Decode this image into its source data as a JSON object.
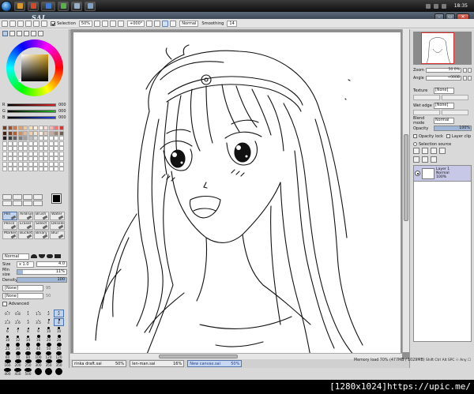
{
  "taskbar": {
    "clock": "18:35",
    "apps": [
      {
        "name": "folder",
        "color": "#d89a2c"
      },
      {
        "name": "browser",
        "color": "#d24a2e"
      },
      {
        "name": "media",
        "color": "#3f7ad0"
      },
      {
        "name": "app",
        "color": "#5ab04a"
      },
      {
        "name": "app",
        "color": "#9ab0c8"
      },
      {
        "name": "sai",
        "color": "#7fa3c8"
      }
    ]
  },
  "window": {
    "title": "SAI",
    "min_label": "–",
    "max_label": "▭",
    "close_label": "✕"
  },
  "menu": [
    "File(F)",
    "Edit(E)",
    "Canvas(C)",
    "Layer(L)",
    "Selection(S)",
    "Filter(T)",
    "View(V)",
    "Window(W)",
    "Help/Config(H)"
  ],
  "toolbar": {
    "selection_label": "Selection",
    "zoom": "50%",
    "angle": "+000°",
    "blend": "Normal",
    "smoothing_label": "Smoothing",
    "smoothing_value": "14"
  },
  "color_sliders": [
    {
      "letter": "R",
      "value": "000",
      "color": "#e02020"
    },
    {
      "letter": "G",
      "value": "000",
      "color": "#20b020"
    },
    {
      "letter": "B",
      "value": "000",
      "color": "#2040e0"
    }
  ],
  "swatches": [
    "#6d3e2a",
    "#a0522d",
    "#c8784a",
    "#e0a070",
    "#f2c89a",
    "#f8dfc0",
    "#fdeede",
    "#fff4ec",
    "#ffd8d8",
    "#ffb0b0",
    "#ff7070",
    "#e03030",
    "#402010",
    "#804020",
    "#b06030",
    "#d09060",
    "#e8b890",
    "#f0d0b0",
    "#f6e4d0",
    "#fbf0e4",
    "#e0c8b8",
    "#c8a898",
    "#a08070",
    "#706050",
    "#202020",
    "#404040",
    "#606060",
    "#808080",
    "#a0a0a0",
    "#c0c0c0",
    "#e0e0e0",
    "#ffffff",
    "#ffffff",
    "#ffffff",
    "#ffffff",
    "#ffffff",
    "#ffffff",
    "#ffffff",
    "#ffffff",
    "#ffffff",
    "#ffffff",
    "#ffffff",
    "#ffffff",
    "#ffffff",
    "#ffffff",
    "#ffffff",
    "#ffffff",
    "#ffffff",
    "#ffffff",
    "#ffffff",
    "#ffffff",
    "#ffffff",
    "#ffffff",
    "#ffffff",
    "#ffffff",
    "#ffffff",
    "#ffffff",
    "#ffffff",
    "#ffffff",
    "#ffffff",
    "#ffffff",
    "#ffffff",
    "#ffffff",
    "#ffffff",
    "#ffffff",
    "#ffffff",
    "#ffffff",
    "#ffffff",
    "#ffffff",
    "#ffffff",
    "#ffffff",
    "#ffffff",
    "#ffffff",
    "#ffffff",
    "#ffffff",
    "#ffffff",
    "#ffffff",
    "#ffffff",
    "#ffffff",
    "#ffffff",
    "#ffffff",
    "#ffffff",
    "#ffffff",
    "#ffffff",
    "#ffffff",
    "#ffffff",
    "#ffffff",
    "#ffffff",
    "#ffffff",
    "#ffffff",
    "#ffffff",
    "#ffffff",
    "#ffffff",
    "#ffffff",
    "#ffffff",
    "#ffffff",
    "#ffffff",
    "#ffffff",
    "#ffffff",
    "#ffffff",
    "#ffffff",
    "#ffffff",
    "#ffffff",
    "#ffffff",
    "#ffffff",
    "#ffffff",
    "#ffffff",
    "#ffffff"
  ],
  "brushes": [
    {
      "label": "Pen",
      "active": true
    },
    {
      "label": "AirBrush"
    },
    {
      "label": "Brush"
    },
    {
      "label": "Water"
    },
    {
      "label": "Pencil"
    },
    {
      "label": "Eraser"
    },
    {
      "label": "Select"
    },
    {
      "label": "Deselect"
    },
    {
      "label": "Marker"
    },
    {
      "label": "Bucket"
    },
    {
      "label": "Binary"
    },
    {
      "label": "Blur"
    }
  ],
  "brush_props": {
    "blend": "Normal",
    "size_label": "Size",
    "size_mult": "x 1.0",
    "size_value": "4.0",
    "min_size_label": "Min size",
    "min_size_value": "11%",
    "min_size_fraction": 0.11,
    "density_label": "Density",
    "density_value": "100",
    "density_fraction": 1.0,
    "texture_1": "[None]",
    "texture_1_value": "95",
    "texture_2": "[None]",
    "texture_2_value": "50",
    "advanced_label": "Advanced"
  },
  "brush_dots": [
    {
      "label": "0.7",
      "size": 1
    },
    {
      "label": "0.8",
      "size": 1
    },
    {
      "label": "1",
      "size": 1
    },
    {
      "label": "1.5",
      "size": 1
    },
    {
      "label": "2",
      "size": 1
    },
    {
      "label": "2",
      "size": 1,
      "selected": true
    },
    {
      "label": "2.3",
      "size": 1
    },
    {
      "label": "2.6",
      "size": 1
    },
    {
      "label": "3",
      "size": 1
    },
    {
      "label": "3.5",
      "size": 1
    },
    {
      "label": "4",
      "size": 2
    },
    {
      "label": "4",
      "size": 2,
      "selected": true
    },
    {
      "label": "6",
      "size": 2
    },
    {
      "label": "7",
      "size": 2
    },
    {
      "label": "8",
      "size": 2
    },
    {
      "label": "9",
      "size": 2
    },
    {
      "label": "10",
      "size": 3
    },
    {
      "label": "10",
      "size": 3
    },
    {
      "label": "10",
      "size": 3
    },
    {
      "label": "12",
      "size": 3
    },
    {
      "label": "14",
      "size": 3
    },
    {
      "label": "16",
      "size": 4
    },
    {
      "label": "20",
      "size": 4
    },
    {
      "label": "20",
      "size": 4
    },
    {
      "label": "25",
      "size": 4
    },
    {
      "label": "30",
      "size": 5
    },
    {
      "label": "35",
      "size": 5
    },
    {
      "label": "40",
      "size": 5
    },
    {
      "label": "50",
      "size": 6
    },
    {
      "label": "50",
      "size": 6
    },
    {
      "label": "60",
      "size": 6
    },
    {
      "label": "70",
      "size": 6
    },
    {
      "label": "80",
      "size": 7
    },
    {
      "label": "100",
      "size": 7
    },
    {
      "label": "120",
      "size": 7
    },
    {
      "label": "120",
      "size": 7
    },
    {
      "label": "160",
      "size": 8
    },
    {
      "label": "200",
      "size": 8
    },
    {
      "label": "250",
      "size": 8
    },
    {
      "label": "300",
      "size": 8
    },
    {
      "label": "350",
      "size": 8
    },
    {
      "label": "350",
      "size": 8
    },
    {
      "label": "400",
      "size": 9
    },
    {
      "label": "450",
      "size": 9
    },
    {
      "label": "500",
      "size": 9
    },
    {
      "label": "",
      "size": 9
    },
    {
      "label": "",
      "size": 9
    },
    {
      "label": "",
      "size": 9
    }
  ],
  "navigator": {
    "zoom_label": "Zoom",
    "zoom_value": "50.0%",
    "angle_label": "Angle",
    "angle_value": "+000B"
  },
  "layer_props": {
    "texture_label": "Texture",
    "texture_value": "[None]",
    "wet_edge_label": "Wet edge",
    "wet_edge_value": "[None]",
    "blend_label": "Blend mode",
    "blend_value": "Normal",
    "opacity_label": "Opacity",
    "opacity_value": "100%",
    "opacity_fraction": 1.0,
    "opacity_lock": "Opacity lock",
    "layer_clip": "Layer clip",
    "selection_source": "Selection source"
  },
  "layers": [
    {
      "name": "Layer 1",
      "mode": "Normal",
      "opacity": "100%"
    }
  ],
  "documents": [
    {
      "name": "rinka draft.sai",
      "zoom": "50%"
    },
    {
      "name": "len-man.sai",
      "zoom": "16%"
    },
    {
      "name": "New canvas.sai",
      "zoom": "50%",
      "active": true
    }
  ],
  "status": {
    "memory": "Memory load 70% (477MB / 1029MB)",
    "indicators": "Shift Ctrl Alt SPC ☉ Any ☐"
  },
  "watermark": "[1280x1024]https://upic.me/"
}
